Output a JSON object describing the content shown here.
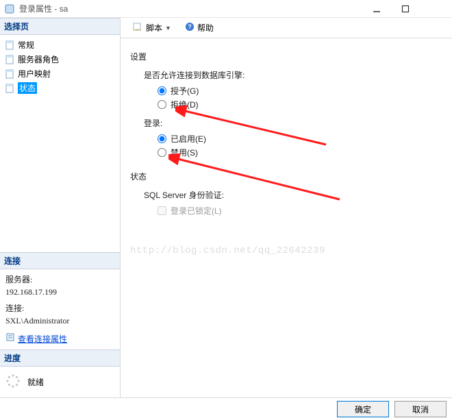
{
  "window": {
    "title": "登录属性 - sa"
  },
  "sidebar": {
    "select_page_header": "选择页",
    "items": [
      {
        "label": "常规"
      },
      {
        "label": "服务器角色"
      },
      {
        "label": "用户映射"
      },
      {
        "label": "状态",
        "selected": true
      }
    ],
    "connection_header": "连接",
    "server_label": "服务器:",
    "server_value": "192.168.17.199",
    "conn_label": "连接:",
    "conn_value": "SXL\\Administrator",
    "view_conn_props": "查看连接属性",
    "progress_header": "进度",
    "progress_status": "就绪"
  },
  "toolbar": {
    "script": "脚本",
    "help": "帮助"
  },
  "content": {
    "settings_label": "设置",
    "permit_db_label": "是否允许连接到数据库引擎:",
    "grant_label": "授予(G)",
    "deny_label": "拒绝(D)",
    "login_label": "登录:",
    "enabled_label": "已启用(E)",
    "disabled_label": "禁用(S)",
    "status_label": "状态",
    "sql_auth_label": "SQL Server 身份验证:",
    "locked_label": "登录已锁定(L)"
  },
  "footer": {
    "ok": "确定",
    "cancel": "取消"
  },
  "watermark": "http://blog.csdn.net/qq_22642239"
}
